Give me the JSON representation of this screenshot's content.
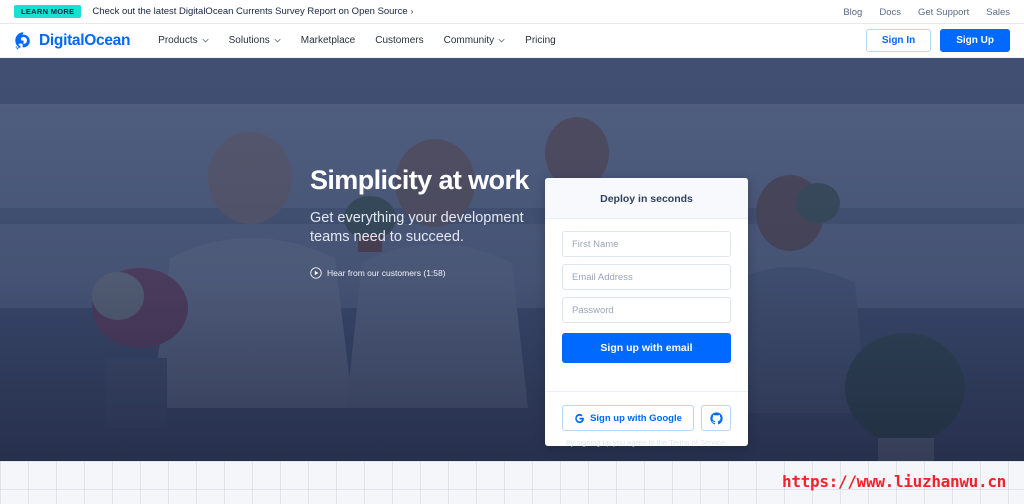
{
  "announcement": {
    "badge": "LEARN MORE",
    "text": "Check out the latest DigitalOcean Currents Survey Report on Open Source",
    "arrow": "›",
    "links": [
      {
        "label": "Blog"
      },
      {
        "label": "Docs"
      },
      {
        "label": "Get Support"
      },
      {
        "label": "Sales"
      }
    ]
  },
  "nav": {
    "logo_text": "DigitalOcean",
    "logo_icon": "digitalocean-droplet-icon",
    "links": [
      {
        "label": "Products",
        "has_dropdown": true
      },
      {
        "label": "Solutions",
        "has_dropdown": true
      },
      {
        "label": "Marketplace",
        "has_dropdown": false
      },
      {
        "label": "Customers",
        "has_dropdown": false
      },
      {
        "label": "Community",
        "has_dropdown": true
      },
      {
        "label": "Pricing",
        "has_dropdown": false
      }
    ],
    "sign_in": "Sign In",
    "sign_up": "Sign Up"
  },
  "hero": {
    "title": "Simplicity at work",
    "subtitle": "Get everything your development teams need to succeed.",
    "video_label": "Hear from our customers (1:58)",
    "video_icon": "play-circle-icon"
  },
  "signup_card": {
    "title": "Deploy in seconds",
    "fields": [
      {
        "name": "first-name",
        "placeholder": "First Name",
        "value": ""
      },
      {
        "name": "email",
        "placeholder": "Email Address",
        "value": ""
      },
      {
        "name": "password",
        "placeholder": "Password",
        "value": ""
      }
    ],
    "email_button": "Sign up with email",
    "google_button": "Sign up with Google",
    "google_icon": "google-g-icon",
    "github_icon": "github-icon",
    "terms": "By signing up you agree to the Terms of Service."
  },
  "watermark": {
    "text": "https://www.liuzhanwu.cn"
  },
  "colors": {
    "brand_blue": "#0069ff",
    "badge_cyan": "#19e0cf",
    "hero_overlay": "#24355e",
    "watermark_red": "#f5222d",
    "card_head_bg": "#f7f9fc"
  }
}
